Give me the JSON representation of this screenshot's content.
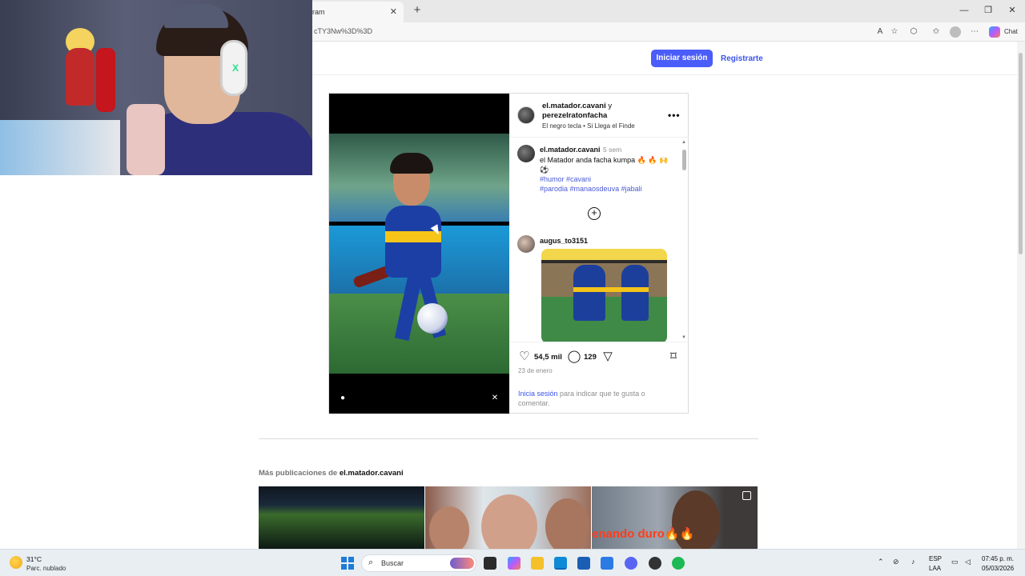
{
  "browser": {
    "tab_title": "ram",
    "tab_close": "✕",
    "new_tab": "+",
    "url": "cTY3Nw%3D%3D",
    "chat_label": "Chat",
    "minimize": "—",
    "restore": "❐",
    "close": "✕"
  },
  "header": {
    "login_button": "Iniciar sesión",
    "register_link": "Registrarte"
  },
  "post": {
    "author_line1": "el.matador.cavani",
    "author_join": " y",
    "author_line2": "perezelratonfacha",
    "audio": "El negro tecla • Si Llega el Finde",
    "more": "•••",
    "caption": {
      "user": "el.matador.cavani",
      "time": "5 sem",
      "text": "el Matador anda facha kumpa 🔥 🔥 🙌 ⚽",
      "tags_line1": "#humor #cavani",
      "tags_line2": "#parodia #manaosdeuva #jabali"
    },
    "reply": {
      "user": "augus_to3151"
    },
    "likes": "54,5 mil",
    "comments_count": "129",
    "date": "23 de enero",
    "login_link": "Inicia sesión",
    "login_text": " para indicar que te gusta o comentar."
  },
  "more_posts": {
    "label": "Más publicaciones de ",
    "user": "el.matador.cavani",
    "grid_3_text": "enando duro🔥🔥"
  },
  "taskbar": {
    "temperature": "31°C",
    "weather": "Parc. nublado",
    "search_placeholder": "Buscar",
    "lang_top": "ESP",
    "lang_bottom": "LAA",
    "time": "07:45 p. m.",
    "date": "05/03/2026"
  },
  "colors": {
    "accent": "#4a5df9",
    "link": "#3b55e6",
    "hashtag": "#4a5ad6"
  }
}
